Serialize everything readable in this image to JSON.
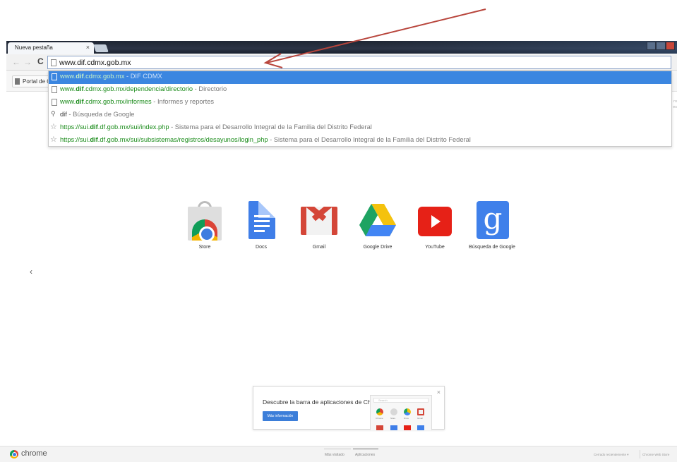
{
  "browser": {
    "tab_title": "Nueva pestaña",
    "tab_close": "×",
    "omnibox_value": "www.dif.cdmx.gob.mx",
    "nav_back": "←",
    "nav_forward": "→",
    "nav_reload": "C",
    "bookmark_label": "Portal de O"
  },
  "suggestions": [
    {
      "icon": "page-icon",
      "url_pre": "www.",
      "url_bold": "dif",
      "url_post": ".cdmx.gob.mx",
      "desc": " - DIF CDMX",
      "selected": true
    },
    {
      "icon": "page-icon",
      "url_pre": "www.",
      "url_bold": "dif",
      "url_post": ".cdmx.gob.mx/dependencia/directorio",
      "desc": " - Directorio",
      "selected": false
    },
    {
      "icon": "page-icon",
      "url_pre": "www.",
      "url_bold": "dif",
      "url_post": ".cdmx.gob.mx/informes",
      "desc": " - Informes y reportes",
      "selected": false
    },
    {
      "icon": "search-icon",
      "query": "dif",
      "desc": " - Búsqueda de Google"
    },
    {
      "icon": "star-icon",
      "url_pre": "https://sui.",
      "url_bold": "dif",
      "url_post": ".df.gob.mx/sui/index.php",
      "desc": " - Sistema para el Desarrollo Integral de la Familia del Distrito Federal"
    },
    {
      "icon": "star-icon",
      "url_pre": "https://sui.",
      "url_bold": "dif",
      "url_post": ".df.gob.mx/sui/subsistemas/registros/desayunos/login_php",
      "desc": " - Sistema para el Desarrollo Integral de la Familia del Distrito Federal"
    }
  ],
  "apps": [
    {
      "id": "store",
      "label": "Store"
    },
    {
      "id": "docs",
      "label": "Docs"
    },
    {
      "id": "gmail",
      "label": "Gmail"
    },
    {
      "id": "drive",
      "label": "Google Drive"
    },
    {
      "id": "youtube",
      "label": "YouTube"
    },
    {
      "id": "google-search",
      "label": "Búsqueda de Google"
    }
  ],
  "prev_arrow": "‹",
  "promo": {
    "text": "Descubre la barra de aplicaciones de Chrome",
    "button": "Más información",
    "close": "×",
    "mini_search": "Search",
    "mini_labels": [
      "Chrome",
      "Store",
      "Drive",
      "Gmail"
    ]
  },
  "bottom": {
    "logo_text": "chrome",
    "nav_most_visited": "Más visitado",
    "nav_apps": "Aplicaciones",
    "recently_closed": "Cerrado recientemente ▾",
    "web_store": "Chrome Web Store"
  },
  "colors": {
    "selected_row": "#3b86e0",
    "url_green": "#1b8c1b",
    "annotation_arrow": "#b8453c"
  }
}
